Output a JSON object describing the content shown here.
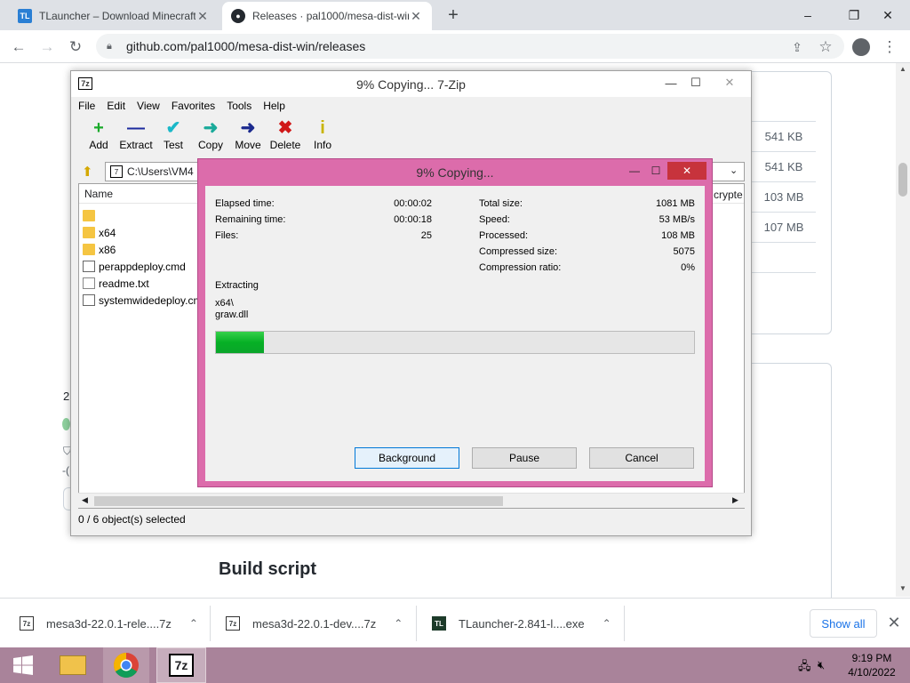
{
  "browser": {
    "tabs": [
      {
        "title": "TLauncher – Download Minecraft",
        "favicon": "TL"
      },
      {
        "title": "Releases · pal1000/mesa-dist-win"
      }
    ],
    "new_tab": "+",
    "url": "github.com/pal1000/mesa-dist-win/releases",
    "window_controls": {
      "minimize": "–",
      "restore": "❐",
      "close": "✕"
    }
  },
  "page": {
    "asset_sizes": [
      "541 KB",
      "541 KB",
      "103 MB",
      "107 MB"
    ],
    "build_script": "Build script",
    "partial_left": [
      "2",
      "-("
    ],
    "partial_crypte": "crypte"
  },
  "zip": {
    "title": "9% Copying... 7-Zip",
    "app_icon": "7z",
    "menu": [
      "File",
      "Edit",
      "View",
      "Favorites",
      "Tools",
      "Help"
    ],
    "tools": [
      {
        "label": "Add",
        "icon": "+",
        "color": "#1aaa2a"
      },
      {
        "label": "Extract",
        "icon": "—",
        "color": "#1b2a9e"
      },
      {
        "label": "Test",
        "icon": "✔",
        "color": "#1ab8c8"
      },
      {
        "label": "Copy",
        "icon": "➜",
        "color": "#1aaa9a"
      },
      {
        "label": "Move",
        "icon": "➜",
        "color": "#1b2a8e"
      },
      {
        "label": "Delete",
        "icon": "✖",
        "color": "#d01818"
      },
      {
        "label": "Info",
        "icon": "i",
        "color": "#c8b400"
      }
    ],
    "path": "C:\\Users\\VM4",
    "column_name": "Name",
    "files": [
      {
        "name": "",
        "type": "folder"
      },
      {
        "name": "x64",
        "type": "folder"
      },
      {
        "name": "x86",
        "type": "folder"
      },
      {
        "name": "perappdeploy.cmd",
        "type": "cmd"
      },
      {
        "name": "readme.txt",
        "type": "doc"
      },
      {
        "name": "systemwidedeploy.cmd",
        "type": "cmd"
      }
    ],
    "status": "0 / 6 object(s) selected"
  },
  "progress": {
    "title": "9% Copying...",
    "left": [
      {
        "label": "Elapsed time:",
        "value": "00:00:02"
      },
      {
        "label": "Remaining time:",
        "value": "00:00:18"
      },
      {
        "label": "Files:",
        "value": "25"
      }
    ],
    "right": [
      {
        "label": "Total size:",
        "value": "1081 MB"
      },
      {
        "label": "Speed:",
        "value": "53 MB/s"
      },
      {
        "label": "Processed:",
        "value": "108 MB"
      },
      {
        "label": "Compressed size:",
        "value": "5075"
      },
      {
        "label": "Compression ratio:",
        "value": "0%"
      }
    ],
    "action": "Extracting",
    "current_dir": "x64\\",
    "current_file": "graw.dll",
    "percent": 10,
    "buttons": {
      "background": "Background",
      "pause": "Pause",
      "cancel": "Cancel"
    }
  },
  "downloads": [
    {
      "name": "mesa3d-22.0.1-rele....7z",
      "icon": "7z"
    },
    {
      "name": "mesa3d-22.0.1-dev....7z",
      "icon": "7z"
    },
    {
      "name": "TLauncher-2.841-l....exe",
      "icon": "TL"
    }
  ],
  "show_all": "Show all",
  "taskbar": {
    "time": "9:19 PM",
    "date": "4/10/2022",
    "active_app_label": "7z"
  }
}
